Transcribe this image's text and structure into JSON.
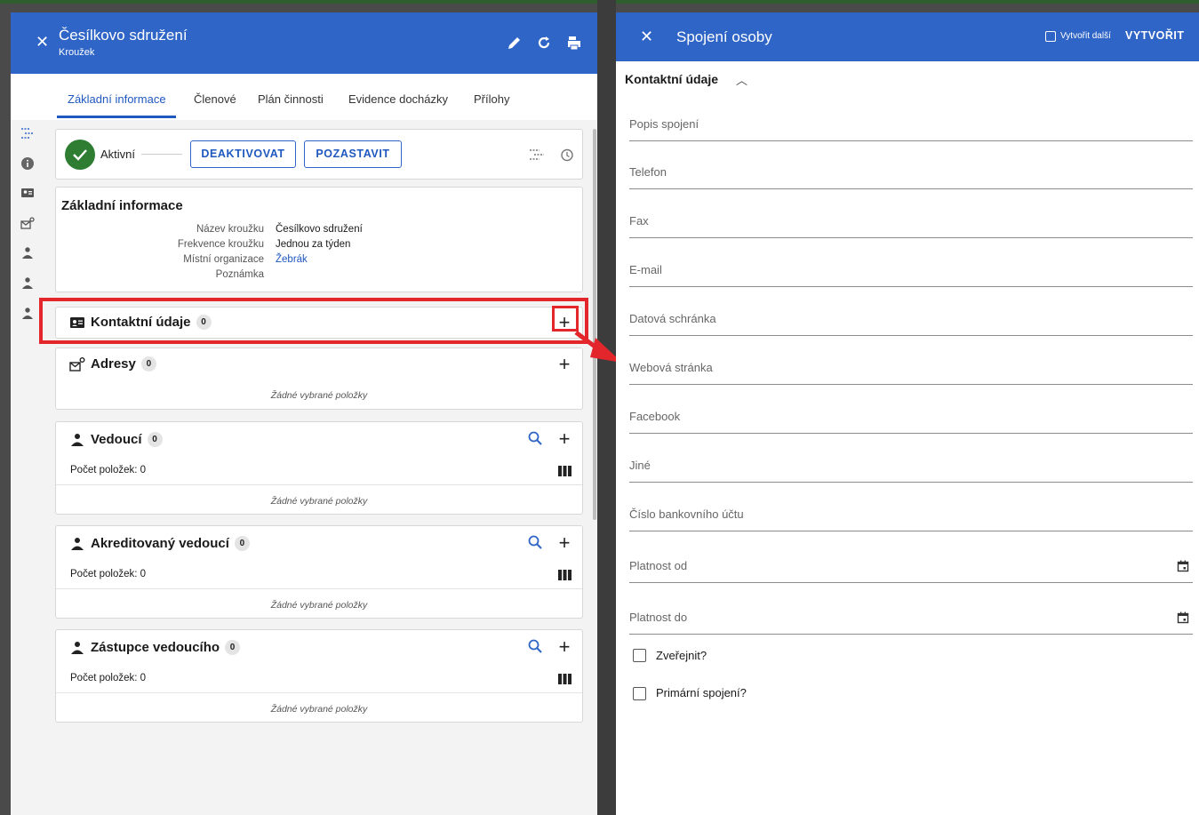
{
  "left_panel": {
    "header": {
      "title": "Česílkovo sdružení",
      "subtitle": "Kroužek"
    },
    "tabs": [
      "Základní informace",
      "Členové",
      "Plán činnosti",
      "Evidence docházky",
      "Přílohy"
    ],
    "status": {
      "label": "Aktivní",
      "deactivate": "DEAKTIVOVAT",
      "suspend": "POZASTAVIT"
    },
    "basic_info": {
      "title": "Základní informace",
      "rows": [
        {
          "label": "Název kroužku",
          "value": "Česílkovo sdružení"
        },
        {
          "label": "Frekvence kroužku",
          "value": "Jednou za týden"
        },
        {
          "label": "Místní organizace",
          "value": "Žebrák"
        },
        {
          "label": "Poznámka",
          "value": ""
        }
      ]
    },
    "contact": {
      "title": "Kontaktní údaje",
      "count": "0"
    },
    "addresses": {
      "title": "Adresy",
      "count": "0",
      "empty": "Žádné vybrané položky"
    },
    "leaders": {
      "title": "Vedoucí",
      "count": "0",
      "items_label": "Počet položek: 0",
      "empty": "Žádné vybrané položky"
    },
    "accredited": {
      "title": "Akreditovaný vedoucí",
      "count": "0",
      "items_label": "Počet položek: 0",
      "empty": "Žádné vybrané položky"
    },
    "deputy": {
      "title": "Zástupce vedoucího",
      "count": "0",
      "items_label": "Počet položek: 0",
      "empty": "Žádné vybrané položky"
    }
  },
  "right_panel": {
    "header": {
      "title": "Spojení osoby",
      "create_another": "Vytvořit další",
      "create": "VYTVOŘIT"
    },
    "section": "Kontaktní údaje",
    "fields": [
      "Popis spojení",
      "Telefon",
      "Fax",
      "E-mail",
      "Datová schránka",
      "Webová stránka",
      "Facebook",
      "Jiné",
      "Číslo bankovního účtu",
      "Platnost od",
      "Platnost do"
    ],
    "checkboxes": [
      "Zveřejnit?",
      "Primární spojení?"
    ]
  },
  "colors": {
    "brand": "#2f65c7",
    "highlight": "#e3262b",
    "status_ok": "#2e7d32"
  }
}
